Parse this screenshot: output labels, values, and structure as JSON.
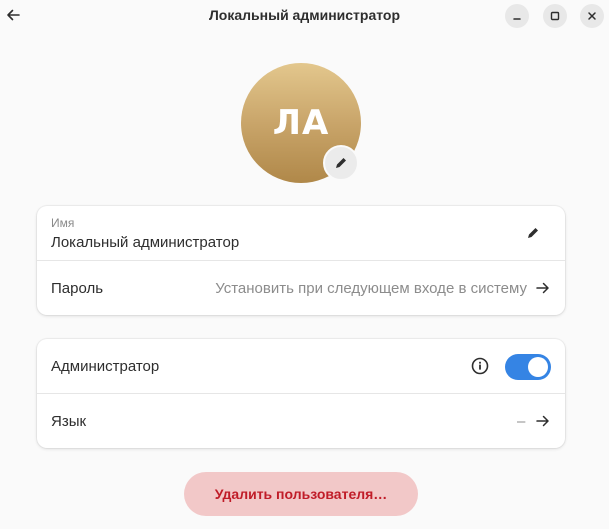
{
  "window": {
    "title": "Локальный администратор"
  },
  "avatar": {
    "initials": "ЛА"
  },
  "account": {
    "name_caption": "Имя",
    "name_value": "Локальный администратор",
    "password_label": "Пароль",
    "password_value": "Установить при следующем входе в систему"
  },
  "settings": {
    "admin_label": "Администратор",
    "admin_enabled": true,
    "language_label": "Язык",
    "language_value": "–"
  },
  "actions": {
    "delete_label": "Удалить пользователя…"
  },
  "colors": {
    "accent": "#3584e4",
    "destructive_text": "#c01c28",
    "destructive_bg": "#f2c8c8"
  },
  "icons": {
    "back": "go-previous-icon",
    "minimize": "window-minimize-icon",
    "maximize": "window-maximize-icon",
    "close": "window-close-icon",
    "edit": "pencil-icon",
    "arrow": "arrow-right-icon",
    "info": "info-icon"
  }
}
